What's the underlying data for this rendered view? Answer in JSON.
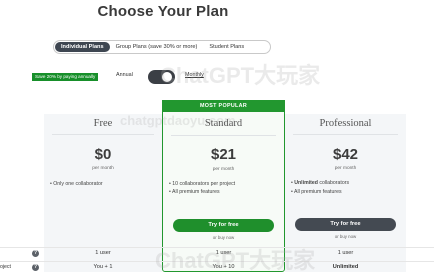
{
  "page": {
    "title": "Choose Your Plan"
  },
  "plan_type_tabs": [
    {
      "label": "Individual Plans",
      "active": true
    },
    {
      "label": "Group Plans (save 30% or more)",
      "active": false
    },
    {
      "label": "Student Plans",
      "active": false
    }
  ],
  "billing": {
    "save_badge": "Save 20% by paying annually",
    "annual_label": "Annual",
    "monthly_label": "Monthly",
    "toggle_state": "monthly"
  },
  "watermarks": [
    "ChatGPT大玩家",
    "chatgptdaoyu.com",
    "ChatGPT大玩家"
  ],
  "plans": {
    "free": {
      "name": "Free",
      "price": "$0",
      "period": "per month",
      "features": [
        "Only one collaborator"
      ]
    },
    "standard": {
      "badge": "MOST POPULAR",
      "name": "Standard",
      "price": "$21",
      "period": "per month",
      "features": [
        "10 collaborators per project",
        "All premium features"
      ],
      "cta": "Try for free",
      "alt_link": "or buy now"
    },
    "professional": {
      "name": "Professional",
      "price": "$42",
      "period": "per month",
      "features": [
        {
          "bold": "Unlimited",
          "rest": " collaborators"
        },
        {
          "bold": "",
          "rest": "All premium features"
        }
      ],
      "cta": "Try for free",
      "alt_link": "or buy now"
    }
  },
  "comparison_rows": [
    {
      "label": "",
      "free": "1 user",
      "standard": "1 user",
      "professional": "1 user"
    },
    {
      "label": "oject",
      "free": "You + 1",
      "standard": "You + 10",
      "professional": "Unlimited"
    }
  ],
  "colors": {
    "brand_green": "#22972f",
    "dark_button": "#444a52",
    "toggle_dark": "#3b3f45"
  },
  "icons": {
    "help": "question-circle-icon"
  }
}
